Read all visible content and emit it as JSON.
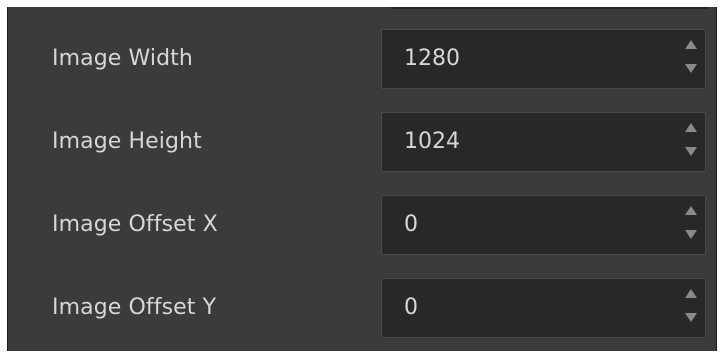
{
  "params": [
    {
      "label": "Image Width",
      "value": "1280"
    },
    {
      "label": "Image Height",
      "value": "1024"
    },
    {
      "label": "Image Offset X",
      "value": "0"
    },
    {
      "label": "Image Offset Y",
      "value": "0"
    }
  ],
  "icons": {
    "increment": "chevron-up-icon",
    "decrement": "chevron-down-icon"
  },
  "colors": {
    "panel_background": "#3b3b3b",
    "field_background": "#282828",
    "text": "#d6d6d6"
  }
}
